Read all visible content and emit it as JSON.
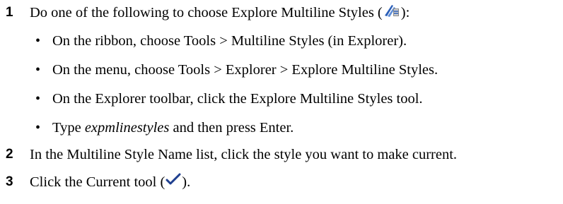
{
  "steps": [
    {
      "number": "1",
      "text_before_icon": "Do one of the following to choose Explore Multiline Styles (",
      "icon": "multiline-styles-icon",
      "text_after_icon": "):",
      "bullets": [
        {
          "text": "On the ribbon, choose Tools > Multiline Styles (in Explorer)."
        },
        {
          "text": "On the menu, choose Tools > Explorer > Explore Multiline Styles."
        },
        {
          "text": "On the Explorer toolbar, click the Explore Multiline Styles tool."
        },
        {
          "prefix": "Type ",
          "emphasis": "expmlinestyles",
          "suffix": " and then press Enter."
        }
      ]
    },
    {
      "number": "2",
      "text": "In the Multiline Style Name list, click the style you want to make current."
    },
    {
      "number": "3",
      "text_before_icon": "Click the Current tool (",
      "icon": "checkmark-icon",
      "text_after_icon": ")."
    }
  ],
  "colors": {
    "checkmark": "#1f3f8f",
    "icon_blue": "#2b5fb8",
    "icon_gray": "#8a8a8a"
  }
}
